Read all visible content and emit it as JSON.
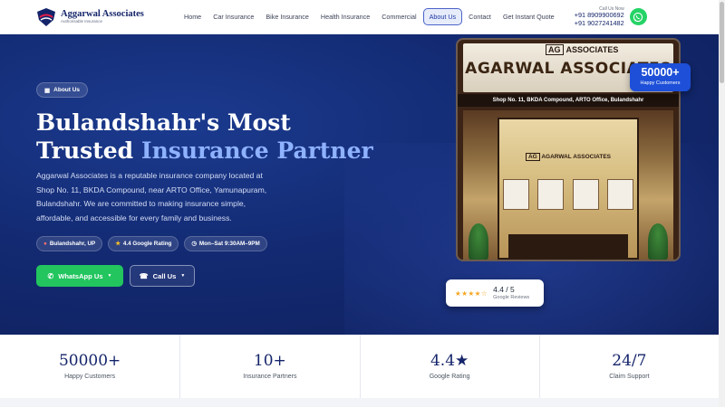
{
  "brand": {
    "name": "Aggarwal Associates",
    "tagline": "Authorisable Insurance"
  },
  "nav": {
    "items": [
      {
        "label": "Home",
        "active": false
      },
      {
        "label": "Car Insurance",
        "active": false
      },
      {
        "label": "Bike Insurance",
        "active": false
      },
      {
        "label": "Health Insurance",
        "active": false
      },
      {
        "label": "Commercial",
        "active": false
      },
      {
        "label": "About Us",
        "active": true
      },
      {
        "label": "Contact",
        "active": false
      },
      {
        "label": "Get Instant Quote",
        "active": false
      }
    ],
    "call_label": "Call Us Now",
    "phone_1": "+91 8909900692",
    "phone_2": "+91 9027241482",
    "whatsapp_icon": "whatsapp-icon"
  },
  "hero": {
    "pill": {
      "icon": "building-icon",
      "label": "About Us"
    },
    "title_line1": "Bulandshahr's Most",
    "title_line2_plain": "Trusted",
    "title_line2_accent": "Insurance Partner",
    "description": "Aggarwal Associates is a reputable insurance company located at Shop No. 11, BKDA Compound, near ARTO Office, Yamunapuram, Bulandshahr. We are committed to making insurance simple, affordable, and accessible for every family and business.",
    "chips": [
      {
        "icon": "pin-icon",
        "label": "Bulandshahr, UP"
      },
      {
        "icon": "star-icon",
        "label": "4.4 Google Rating"
      },
      {
        "icon": "clock-icon",
        "label": "Mon–Sat 9:30AM–9PM"
      }
    ],
    "cta_whatsapp": "WhatsApp Us",
    "cta_call": "Call Us"
  },
  "store_image": {
    "sign_logo": "AG",
    "sign_logo_text": "ASSOCIATES",
    "sign_title": "AGARWAL ASSOCIATES",
    "address": "Shop No. 11, BKDA Compound, ARTO Office, Bulandshahr",
    "door_sign": "AGARWAL ASSOCIATES"
  },
  "badge": {
    "value": "50000+",
    "label": "Happy Customers"
  },
  "rating_card": {
    "stars": "★★★★☆",
    "score": "4.4 / 5",
    "source": "Google Reviews"
  },
  "stats": [
    {
      "value": "50000+",
      "label": "Happy Customers"
    },
    {
      "value": "10+",
      "label": "Insurance Partners"
    },
    {
      "value": "4.4★",
      "label": "Google Rating"
    },
    {
      "value": "24/7",
      "label": "Claim Support"
    }
  ],
  "colors": {
    "navy": "#14246a",
    "accent": "#8fb2ff",
    "whatsapp": "#25d366",
    "badge": "#1d4fd8"
  }
}
